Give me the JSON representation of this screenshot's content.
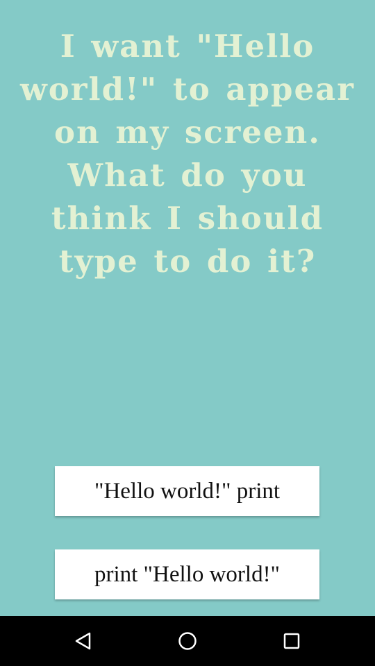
{
  "question": {
    "text": "I want \"Hello world!\" to appear on my screen. What do you think I should type to do it?"
  },
  "answers": [
    {
      "label": "\"Hello world!\" print"
    },
    {
      "label": "print \"Hello world!\""
    }
  ],
  "colors": {
    "background": "#84cac7",
    "question_text": "#e3f1d3",
    "button_background": "#ffffff",
    "button_text": "#111111",
    "navbar": "#000000"
  },
  "navbar": {
    "icons": [
      "back-icon",
      "home-icon",
      "recent-apps-icon"
    ]
  }
}
